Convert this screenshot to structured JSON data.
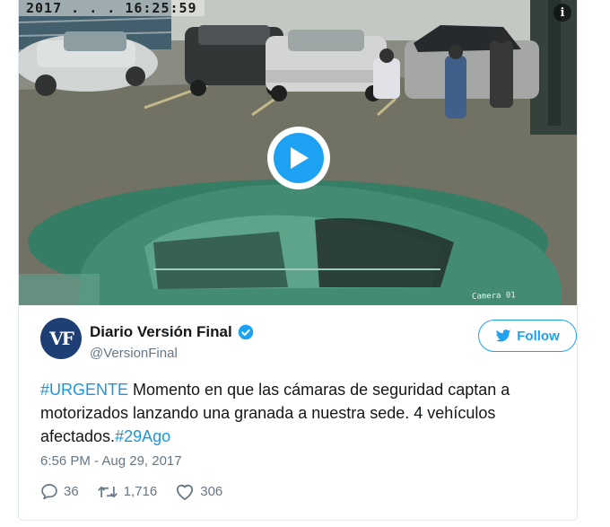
{
  "media": {
    "video_timestamp": "2017 . . . 16:25:59",
    "camera_label": "Camera 01",
    "info_icon": "info-icon",
    "play_icon": "play-icon"
  },
  "tweet": {
    "avatar_initials": "VF",
    "display_name": "Diario Versión Final",
    "verified_icon": "verified-badge-icon",
    "handle": "@VersionFinal",
    "follow_label": "Follow",
    "follow_icon": "twitter-bird-icon",
    "text": {
      "hashtag_1": "#URGENTE",
      "body": " Momento en que las cámaras de seguridad captan a motorizados lanzando una granada a nuestra sede. 4 vehículos afectados.",
      "hashtag_2": "#29Ago"
    },
    "timestamp": "6:56 PM - Aug 29, 2017",
    "actions": {
      "replies": "36",
      "retweets": "1,716",
      "likes": "306"
    }
  },
  "colors": {
    "accent": "#1da1f2",
    "hashtag": "#1b95e0",
    "secondary_text": "#657786",
    "avatar_bg": "#1e3f73"
  }
}
